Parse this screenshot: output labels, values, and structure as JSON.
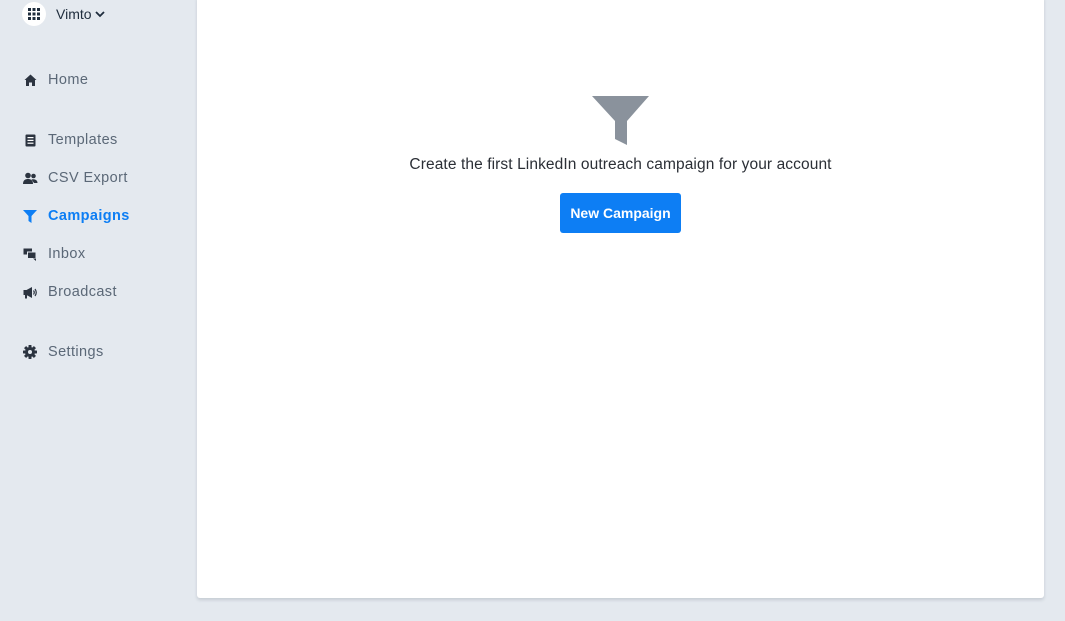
{
  "workspace": {
    "name": "Vimto",
    "icon": "grid-icon"
  },
  "sidebar": {
    "items": [
      {
        "label": "Home",
        "icon": "home-icon"
      },
      {
        "label": "Templates",
        "icon": "templates-icon"
      },
      {
        "label": "CSV Export",
        "icon": "users-icon"
      },
      {
        "label": "Campaigns",
        "icon": "funnel-icon",
        "active": true
      },
      {
        "label": "Inbox",
        "icon": "chat-icon"
      },
      {
        "label": "Broadcast",
        "icon": "megaphone-icon"
      },
      {
        "label": "Settings",
        "icon": "gear-icon"
      }
    ]
  },
  "main": {
    "empty_icon": "funnel-icon",
    "empty_message": "Create the first LinkedIn outreach campaign for your account",
    "new_campaign_label": "New Campaign"
  },
  "colors": {
    "accent": "#0d7ef4",
    "background": "#e4e9ef",
    "nav_text": "#5b6877",
    "empty_icon": "#8a929c"
  }
}
